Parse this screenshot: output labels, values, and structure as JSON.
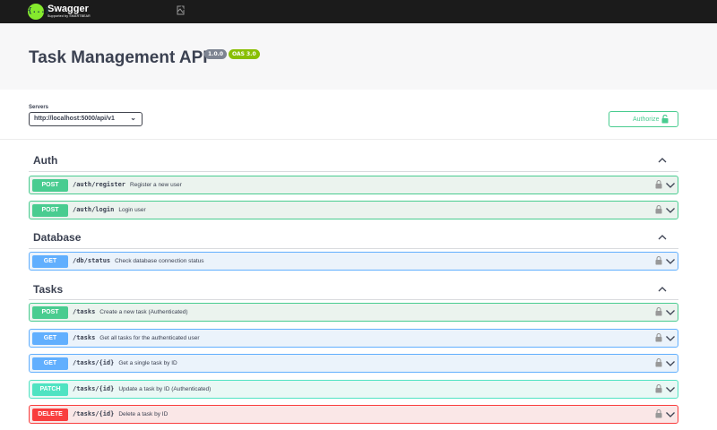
{
  "topbar": {
    "logo_name": "Swagger",
    "logo_sub": "Supported by SMARTBEAR",
    "logo_mark": "{...}",
    "icon": "broken-image-icon"
  },
  "info": {
    "title": "Task Management API",
    "version": "1.0.0",
    "oas": "OAS 3.0"
  },
  "servers": {
    "label": "Servers",
    "selected": "http://localhost:5000/api/v1",
    "authorize_label": "Authorize"
  },
  "colors": {
    "post": "#49cc90",
    "get": "#61affe",
    "patch": "#50e3c2",
    "delete": "#f93e3e"
  },
  "sections": [
    {
      "name": "Auth",
      "ops": [
        {
          "method": "POST",
          "path": "/auth/register",
          "summary": "Register a new user"
        },
        {
          "method": "POST",
          "path": "/auth/login",
          "summary": "Login user"
        }
      ]
    },
    {
      "name": "Database",
      "ops": [
        {
          "method": "GET",
          "path": "/db/status",
          "summary": "Check database connection status"
        }
      ]
    },
    {
      "name": "Tasks",
      "ops": [
        {
          "method": "POST",
          "path": "/tasks",
          "summary": "Create a new task (Authenticated)"
        },
        {
          "method": "GET",
          "path": "/tasks",
          "summary": "Get all tasks for the authenticated user"
        },
        {
          "method": "GET",
          "path": "/tasks/{id}",
          "summary": "Get a single task by ID"
        },
        {
          "method": "PATCH",
          "path": "/tasks/{id}",
          "summary": "Update a task by ID (Authenticated)"
        },
        {
          "method": "DELETE",
          "path": "/tasks/{id}",
          "summary": "Delete a task by ID"
        }
      ]
    }
  ]
}
